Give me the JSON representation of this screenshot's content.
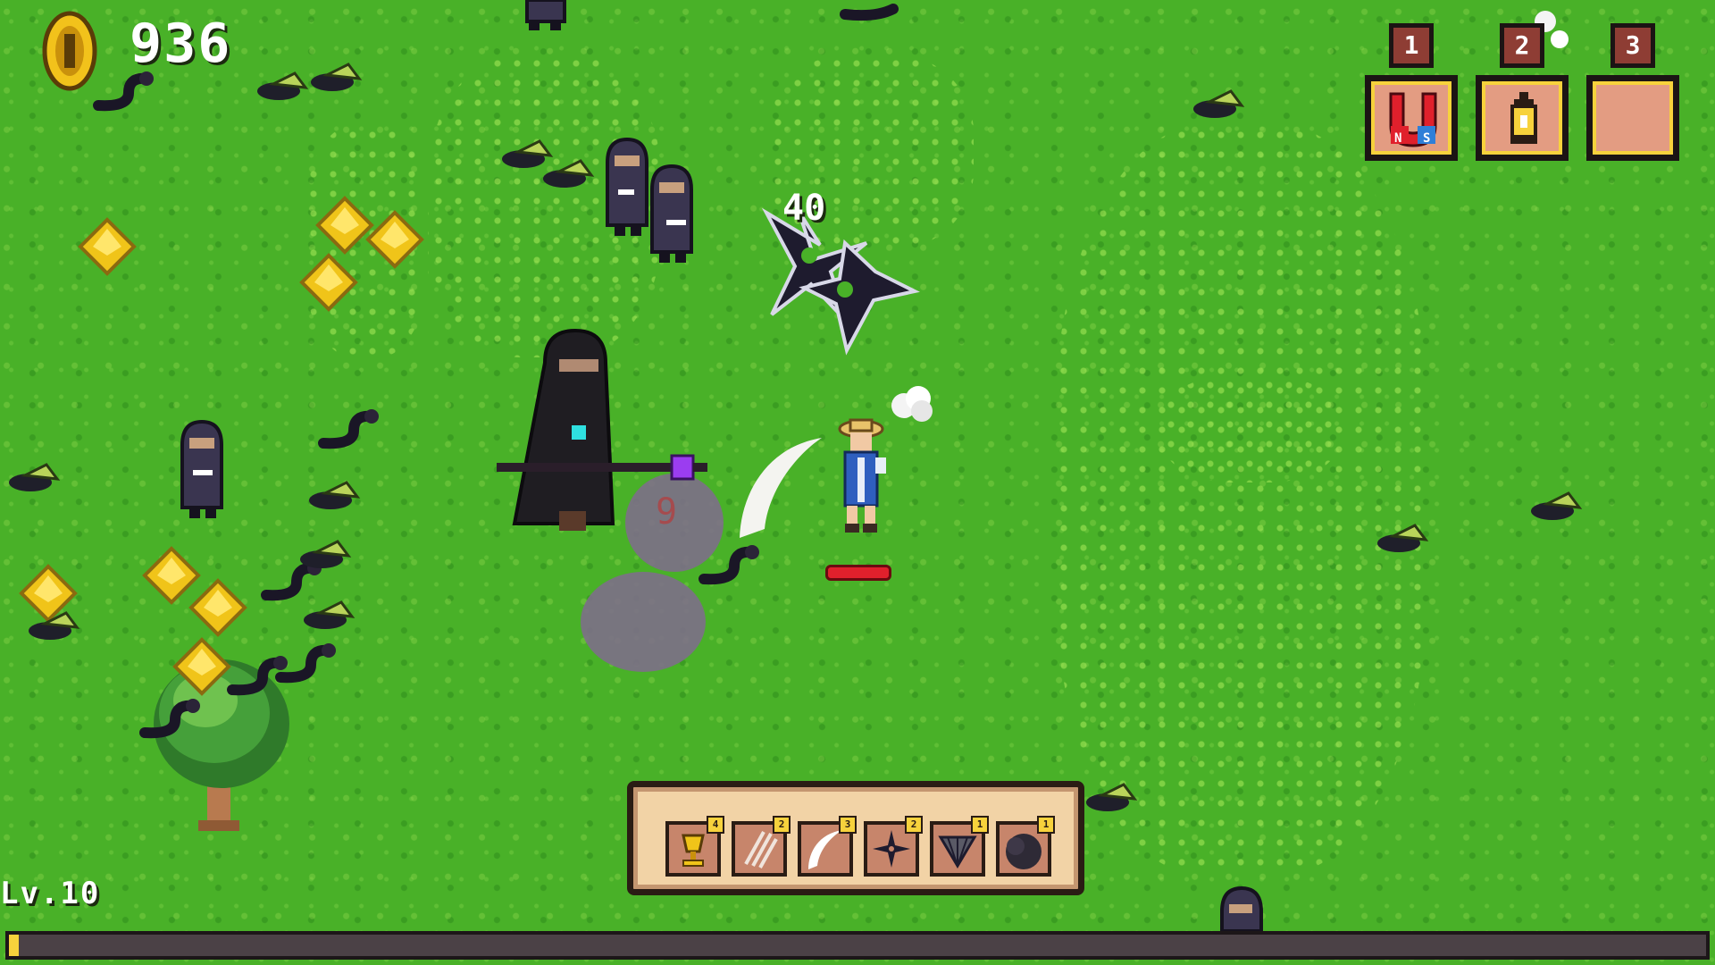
{
  "hud": {
    "coins": "936",
    "level": "Lv.10",
    "xp_progress": 0.006,
    "damage_number": "40",
    "hit_marker": "9"
  },
  "potion_slots": [
    {
      "key": "1",
      "item": "magnet-icon"
    },
    {
      "key": "2",
      "item": "lantern-icon"
    },
    {
      "key": "3",
      "item": null
    }
  ],
  "magnet_poles": {
    "north": "N",
    "south": "S"
  },
  "weapon_hotbar": [
    {
      "item": "golden-chalice-icon",
      "level": "4"
    },
    {
      "item": "claw-slash-icon",
      "level": "2"
    },
    {
      "item": "scythe-blade-icon",
      "level": "3"
    },
    {
      "item": "shuriken-icon",
      "level": "2"
    },
    {
      "item": "fan-icon",
      "level": "1"
    },
    {
      "item": "smoke-cloud-icon",
      "level": "1"
    }
  ],
  "colors": {
    "grass": "#49b128",
    "xp_fill": "#f7d23c",
    "health": "#e0202c",
    "gem": "#f0c419",
    "hotbar_bg": "#f2d3a6"
  }
}
